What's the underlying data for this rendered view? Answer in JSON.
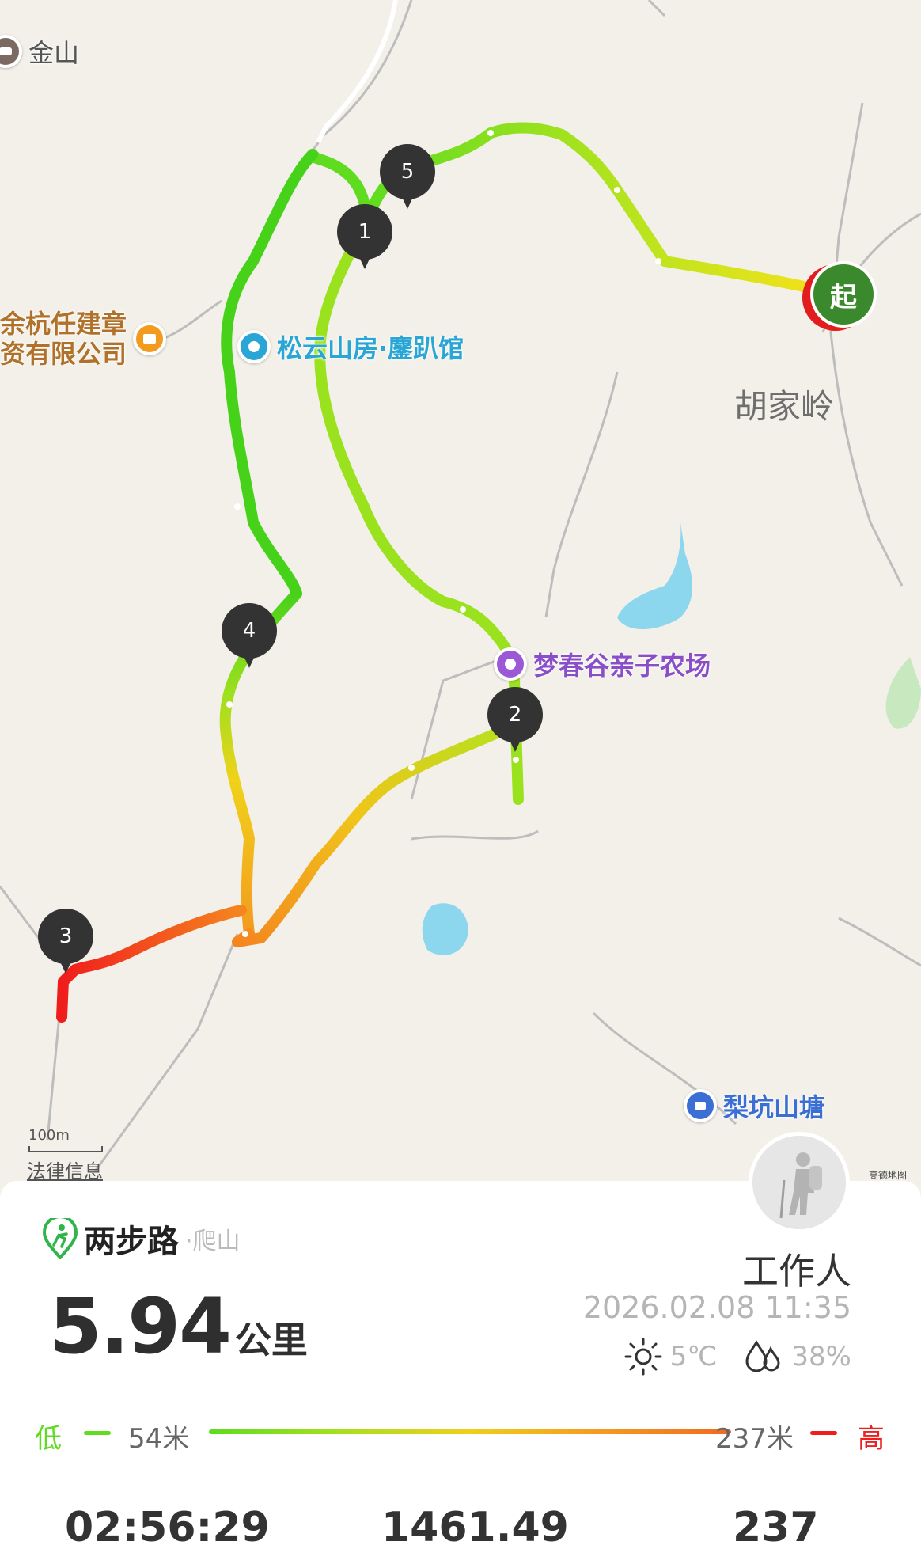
{
  "map": {
    "places": {
      "jinshan": "金山",
      "company": "余杭任建章\n资有限公司",
      "songyun": "松云山房·鏖趴馆",
      "hujialing": "胡家岭",
      "mengchungu": "梦春谷亲子农场",
      "likeng": "梨坑山塘"
    },
    "start_label": "起",
    "markers": [
      "1",
      "2",
      "3",
      "4",
      "5"
    ],
    "scale_label": "100m",
    "legal_label": "法律信息",
    "attribution": "高德地图",
    "colors": {
      "low": "#5fdc1f",
      "mid": "#f0cf1a",
      "high": "#f01d1d",
      "water": "#8cd7ee"
    }
  },
  "panel": {
    "brand_name": "两步路",
    "brand_sub": "·爬山",
    "distance_value": "5.94",
    "distance_unit": "公里",
    "user_name": "工作人",
    "datetime": "2026.02.08 11:35",
    "temperature": "5℃",
    "humidity": "38%",
    "elevation": {
      "low_label": "低",
      "min": "54米",
      "max": "237米",
      "high_label": "高"
    },
    "stats": [
      "02:56:29",
      "1461.49",
      "237"
    ]
  },
  "icons": [
    "company-icon",
    "poi-icon",
    "sun-icon",
    "humidity-icon",
    "brand-logo-icon",
    "hiker-avatar-icon"
  ]
}
